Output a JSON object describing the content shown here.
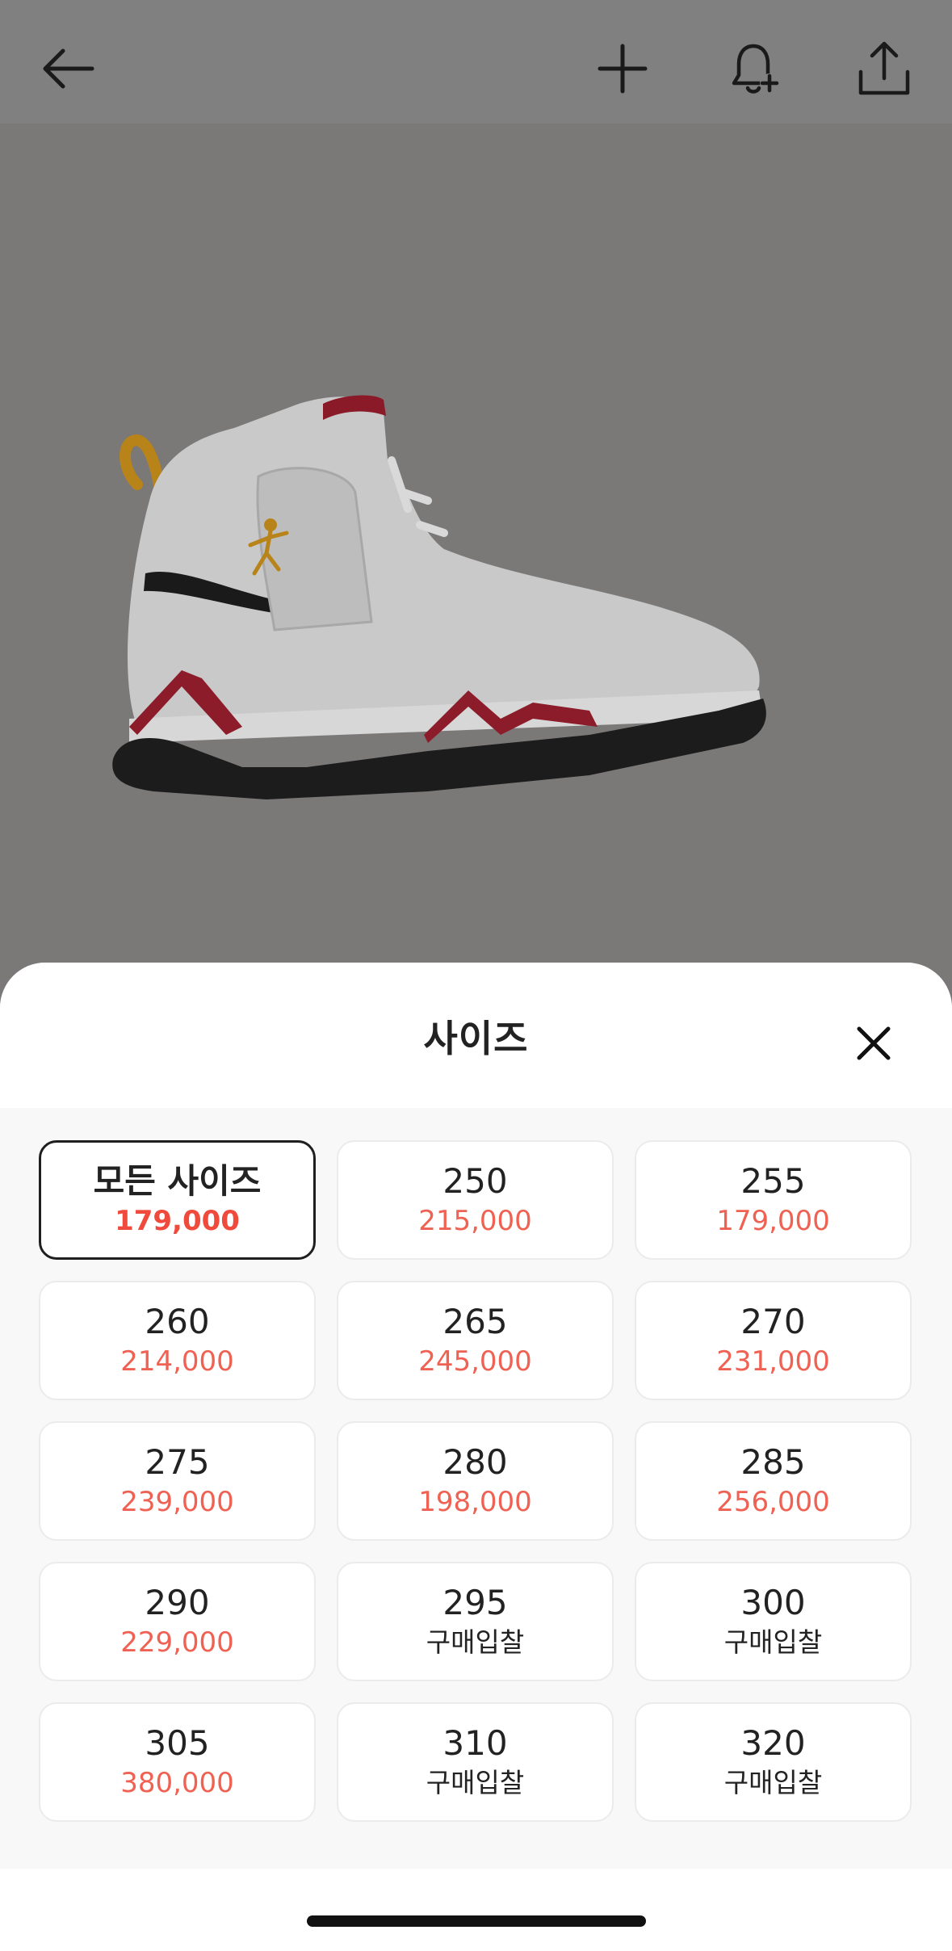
{
  "topbar": {
    "icons": [
      "back-arrow-icon",
      "plus-icon",
      "bell-plus-icon",
      "share-icon"
    ]
  },
  "product": {
    "image": "sneaker-image"
  },
  "sheet": {
    "title": "사이즈",
    "close_icon": "close-icon",
    "sizes": [
      {
        "size": "모든 사이즈",
        "price": "179,000",
        "selected": true
      },
      {
        "size": "250",
        "price": "215,000"
      },
      {
        "size": "255",
        "price": "179,000"
      },
      {
        "size": "260",
        "price": "214,000"
      },
      {
        "size": "265",
        "price": "245,000"
      },
      {
        "size": "270",
        "price": "231,000"
      },
      {
        "size": "275",
        "price": "239,000"
      },
      {
        "size": "280",
        "price": "198,000"
      },
      {
        "size": "285",
        "price": "256,000"
      },
      {
        "size": "290",
        "price": "229,000"
      },
      {
        "size": "295",
        "price": "구매입찰"
      },
      {
        "size": "300",
        "price": "구매입찰"
      },
      {
        "size": "305",
        "price": "380,000"
      },
      {
        "size": "310",
        "price": "구매입찰"
      },
      {
        "size": "320",
        "price": "구매입찰"
      }
    ]
  },
  "colors": {
    "price_red": "#ef6253",
    "selected_border": "#1f1f1f",
    "overlay": "#7b7878"
  }
}
